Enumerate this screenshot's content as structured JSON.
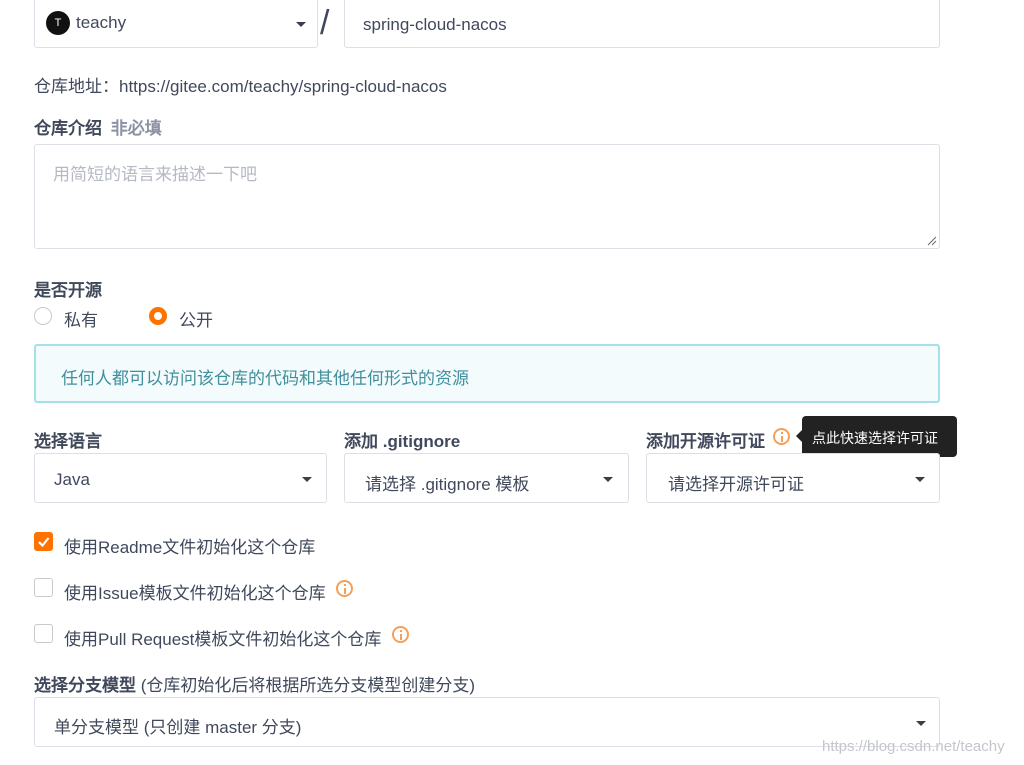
{
  "owner": {
    "avatar_letter": "T",
    "name": "teachy"
  },
  "separator": "/",
  "repo_name": "spring-cloud-nacos",
  "repo_address": "仓库地址：https://gitee.com/teachy/spring-cloud-nacos",
  "description": {
    "label": "仓库介绍",
    "optional": "非必填",
    "placeholder": "用简短的语言来描述一下吧"
  },
  "visibility": {
    "label": "是否开源",
    "options": [
      "私有",
      "公开"
    ],
    "selected": "公开",
    "notice": "任何人都可以访问该仓库的代码和其他任何形式的资源"
  },
  "language": {
    "label": "选择语言",
    "value": "Java"
  },
  "gitignore": {
    "label": "添加 .gitignore",
    "value": "请选择 .gitignore 模板"
  },
  "license": {
    "label": "添加开源许可证",
    "value": "请选择开源许可证",
    "tooltip": "点此快速选择许可证"
  },
  "init_options": [
    {
      "label": "使用Readme文件初始化这个仓库",
      "checked": true
    },
    {
      "label": "使用Issue模板文件初始化这个仓库",
      "checked": false
    },
    {
      "label": "使用Pull Request模板文件初始化这个仓库",
      "checked": false
    }
  ],
  "branch_model": {
    "label": "选择分支模型",
    "hint": "(仓库初始化后将根据所选分支模型创建分支)",
    "value": "单分支模型 (只创建 master 分支)"
  },
  "watermark": "https://blog.csdn.net/teachy",
  "colors": {
    "accent": "#fe7300",
    "notice_bg": "#f3fbfd",
    "notice_border": "#a6dfe9",
    "tooltip_bg": "#222222"
  }
}
